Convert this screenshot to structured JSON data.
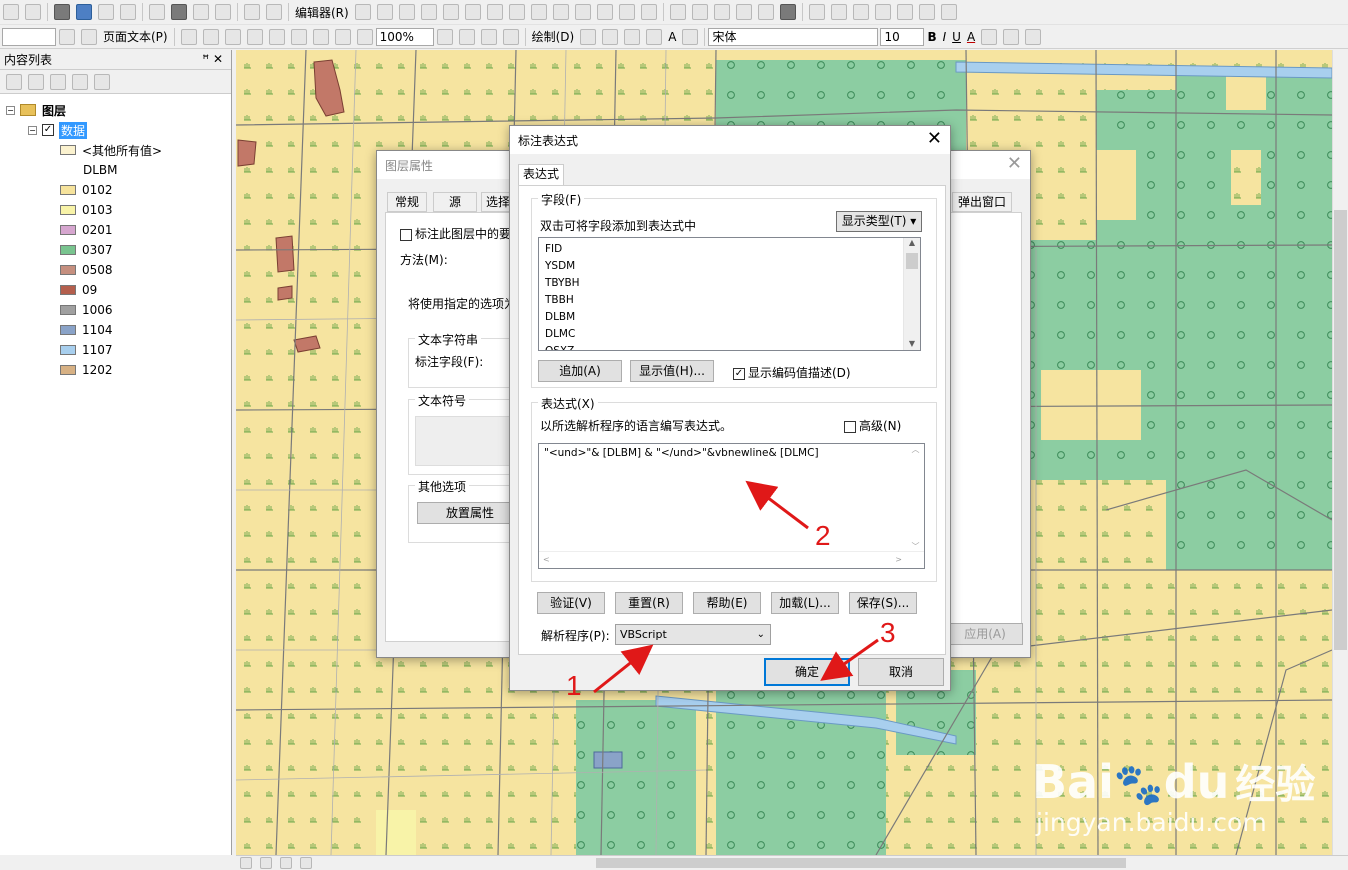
{
  "toolbar": {
    "editor_label": "编辑器(R)",
    "layout_text_label": "页面文本(P)",
    "zoom": "100%",
    "draw_label": "绘制(D)",
    "font_name": "宋体",
    "font_size": "10",
    "bold": "B",
    "italic": "I",
    "underline": "U",
    "text_A": "A"
  },
  "toc": {
    "title": "内容列表",
    "pin": "ꟸ ✕",
    "layers_label": "图层",
    "data_label": "数据",
    "other_values": "<其他所有值>",
    "field_name": "DLBM",
    "legend": [
      {
        "label": "0102",
        "color": "#f6e39c"
      },
      {
        "label": "0103",
        "color": "#f8f3a8"
      },
      {
        "label": "0201",
        "color": "#d6a6cf"
      },
      {
        "label": "0307",
        "color": "#79c48f"
      },
      {
        "label": "0508",
        "color": "#c58f7f"
      },
      {
        "label": "09",
        "color": "#b45f4d"
      },
      {
        "label": "1006",
        "color": "#a0a0a0"
      },
      {
        "label": "1104",
        "color": "#8aa3c8"
      },
      {
        "label": "1107",
        "color": "#a8cfee"
      },
      {
        "label": "1202",
        "color": "#d7b184"
      }
    ]
  },
  "layer_props": {
    "title": "图层属性",
    "tabs": [
      "常规",
      "源",
      "选择"
    ],
    "tab_right": "弹出窗口",
    "label_checkbox": "标注此图层中的要",
    "method_label": "方法(M):",
    "desc": "将使用指定的选项为",
    "text_string_group": "文本字符串",
    "label_field": "标注字段(F):",
    "text_symbol_group": "文本符号",
    "other_options_group": "其他选项",
    "placement_button": "放置属性",
    "apply_button": "应用(A)"
  },
  "expr_dialog": {
    "title": "标注表达式",
    "tab": "表达式",
    "fields_group": "字段(F)",
    "fields_hint": "双击可将字段添加到表达式中",
    "show_types": "显示类型(T)",
    "fields": [
      "FID",
      "YSDM",
      "TBYBH",
      "TBBH",
      "DLBM",
      "DLMC",
      "QSXZ"
    ],
    "append_button": "追加(A)",
    "show_values_button": "显示值(H)...",
    "show_coded_desc": "显示编码值描述(D)",
    "expr_group": "表达式(X)",
    "expr_hint": "以所选解析程序的语言编写表达式。",
    "advanced": "高级(N)",
    "expression": "\"<und>\"& [DLBM] & \"</und>\"&vbnewline& [DLMC]",
    "verify_button": "验证(V)",
    "reset_button": "重置(R)",
    "help_button": "帮助(E)",
    "load_button": "加载(L)...",
    "save_button": "保存(S)...",
    "parser_label": "解析程序(P):",
    "parser_value": "VBScript",
    "ok_button": "确定",
    "cancel_button": "取消"
  },
  "annotations": [
    "1",
    "2",
    "3"
  ],
  "watermark": {
    "brand": "Bai",
    "brand2": "du",
    "cn": "经验",
    "url": "jingyan.baidu.com"
  }
}
